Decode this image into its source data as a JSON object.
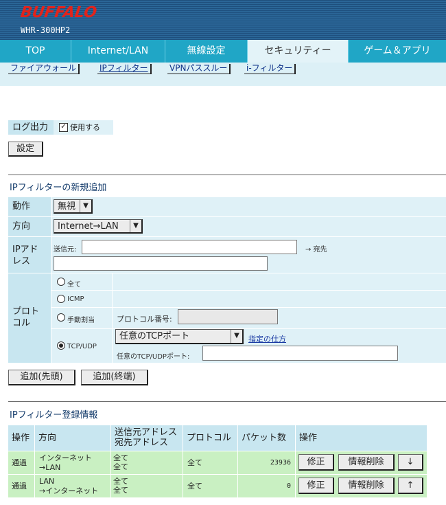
{
  "header": {
    "brand": "BUFFALO",
    "model": "WHR-300HP2"
  },
  "tabs": [
    {
      "label": "TOP"
    },
    {
      "label": "Internet/LAN"
    },
    {
      "label": "無線設定"
    },
    {
      "label": "セキュリティー"
    },
    {
      "label": "ゲーム＆アプリ"
    }
  ],
  "subnav": [
    {
      "label": "ファイアウォール"
    },
    {
      "label": "IPフィルター"
    },
    {
      "label": "VPNパススルー"
    },
    {
      "label": "i-フィルター"
    }
  ],
  "log": {
    "label": "ログ出力",
    "checkbox_label": "使用する",
    "check_mark": "✓",
    "set_button": "設定"
  },
  "add_section": {
    "title": "IPフィルターの新規追加",
    "action_label": "動作",
    "action_value": "無視",
    "direction_label": "方向",
    "direction_value": "Internet→LAN",
    "ip_label_1": "IPアド",
    "ip_label_2": "レス",
    "src_label": "送信元:",
    "dst_label": "→ 宛先",
    "protocol_label_1": "プロト",
    "protocol_label_2": "コル",
    "opt_all": "全て",
    "opt_icmp": "ICMP",
    "opt_manual": "手動割当",
    "protocol_number_label": "プロトコル番号:",
    "opt_tcpudp": "TCP/UDP",
    "tcp_port_select": "任意のTCPポート",
    "howto_link": "指定の仕方",
    "tcp_udp_port_label": "任意のTCP/UDPポート:",
    "add_head_button": "追加(先頭)",
    "add_tail_button": "追加(終端)"
  },
  "registered": {
    "title": "IPフィルター登録情報",
    "headers": {
      "op": "操作",
      "dir": "方向",
      "addr1": "送信元アドレス",
      "addr2": "宛先アドレス",
      "proto": "プロトコル",
      "packets": "パケット数",
      "actions": "操作"
    },
    "rows": [
      {
        "op": "通過",
        "dir1": "インターネット",
        "dir2": "→LAN",
        "src": "全て",
        "dst": "全て",
        "proto": "全て",
        "packets": "23936",
        "edit": "修正",
        "delete": "情報削除",
        "move": "↓"
      },
      {
        "op": "通過",
        "dir1": "LAN",
        "dir2": "→インターネット",
        "src": "全て",
        "dst": "全て",
        "proto": "全て",
        "packets": "0",
        "edit": "修正",
        "delete": "情報削除",
        "move": "↑"
      }
    ]
  },
  "colors": {
    "header_bg": "#2a6596",
    "tab_bg": "#20a6c6",
    "label_bg": "#c8e6f0",
    "row_bg": "#c9f0c2",
    "brand": "#e3231b"
  }
}
